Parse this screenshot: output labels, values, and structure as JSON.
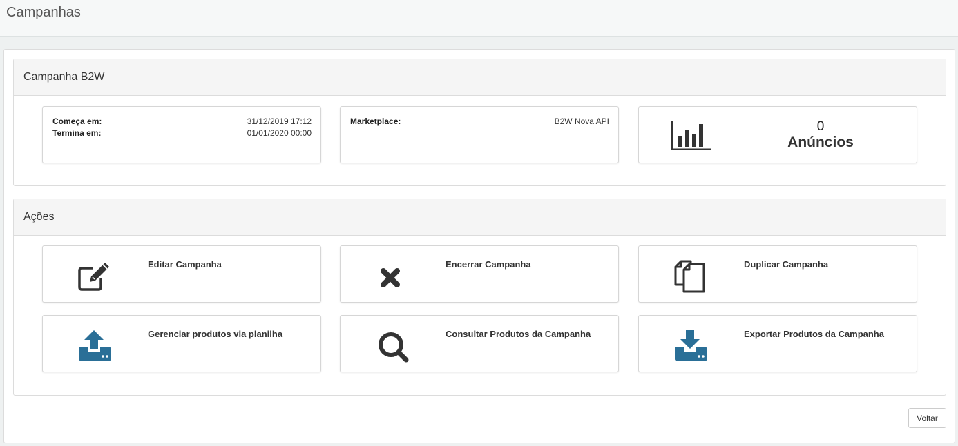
{
  "page": {
    "title": "Campanhas"
  },
  "campaign_panel": {
    "title": "Campanha B2W",
    "dates": {
      "start_label": "Começa em:",
      "start_value": "31/12/2019 17:12",
      "end_label": "Termina em:",
      "end_value": "01/01/2020 00:00"
    },
    "marketplace": {
      "label": "Marketplace:",
      "value": "B2W Nova API"
    },
    "ads_stat": {
      "count": "0",
      "label": "Anúncios",
      "icon": "bar-chart-icon"
    }
  },
  "actions_panel": {
    "title": "Ações",
    "items": [
      {
        "label": "Editar Campanha",
        "icon": "edit-icon"
      },
      {
        "label": "Encerrar Campanha",
        "icon": "close-icon"
      },
      {
        "label": "Duplicar Campanha",
        "icon": "copy-icon"
      },
      {
        "label": "Gerenciar produtos via planilha",
        "icon": "upload-icon"
      },
      {
        "label": "Consultar Produtos da Campanha",
        "icon": "search-icon"
      },
      {
        "label": "Exportar Produtos da Campanha",
        "icon": "download-icon"
      }
    ]
  },
  "footer": {
    "back_label": "Voltar"
  },
  "colors": {
    "accent_icon": "#2a6f97",
    "dark_icon": "#333333"
  }
}
